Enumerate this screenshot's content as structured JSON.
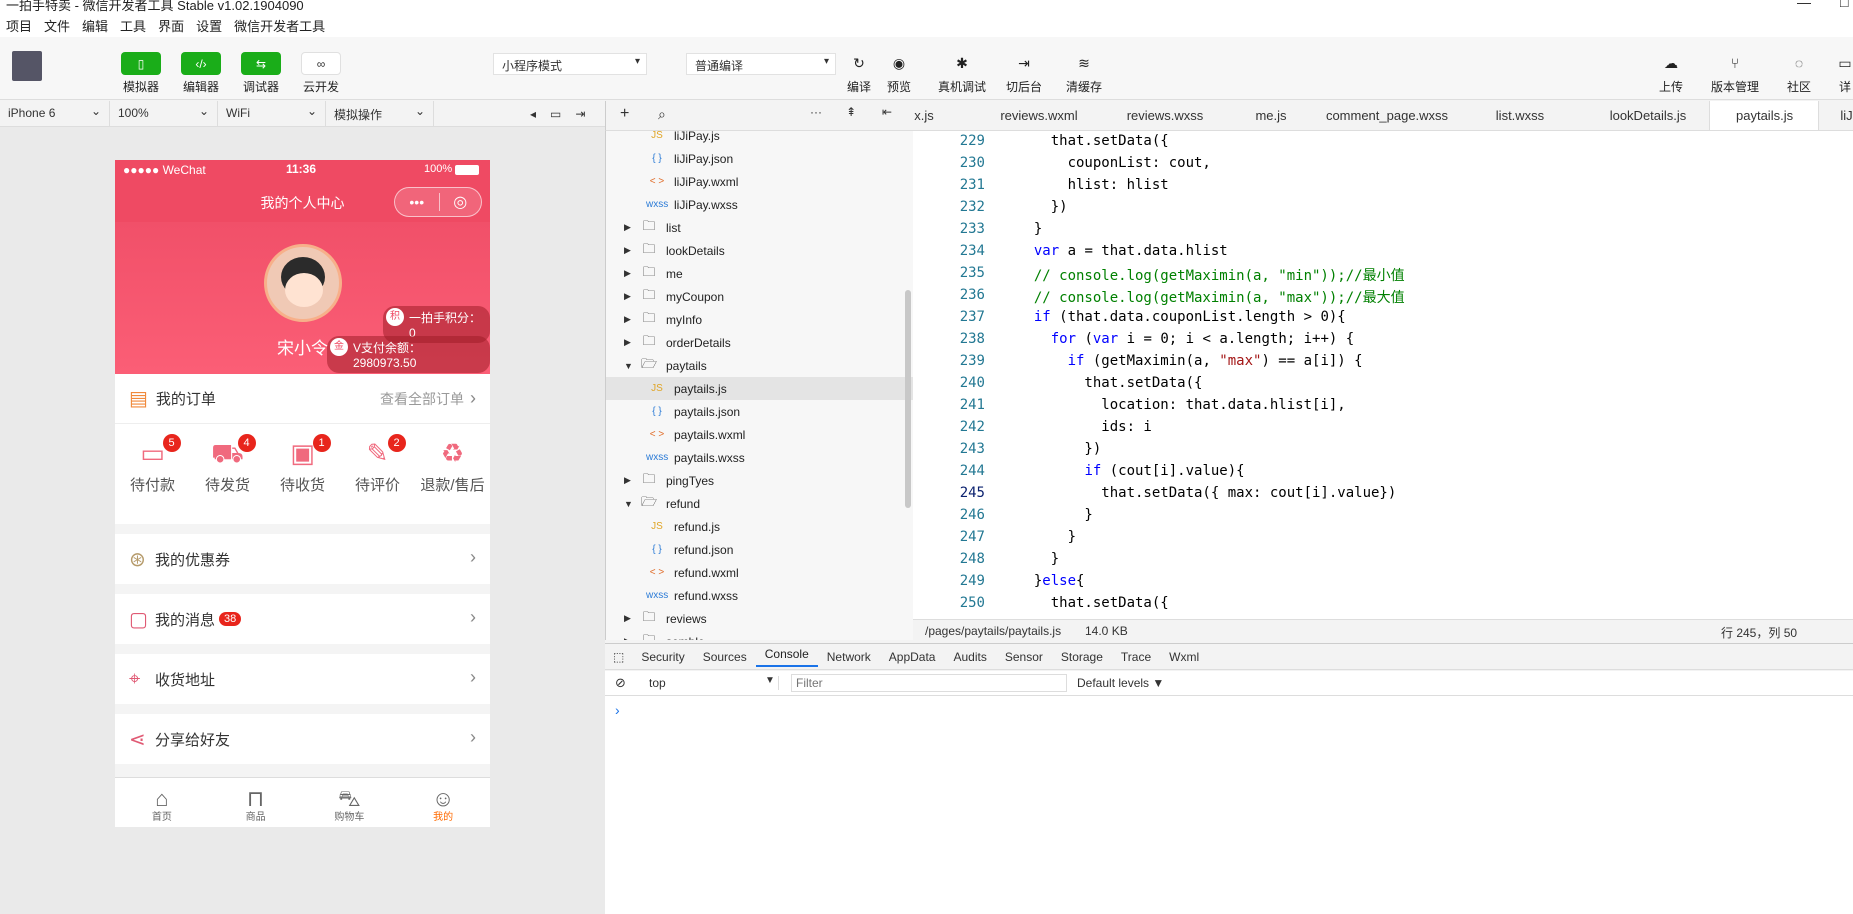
{
  "window": {
    "title": "一拍手特卖 - 微信开发者工具 Stable v1.02.1904090"
  },
  "menu": [
    "项目",
    "文件",
    "编辑",
    "工具",
    "界面",
    "设置",
    "微信开发者工具"
  ],
  "toolbar": {
    "simulator": "模拟器",
    "editor": "编辑器",
    "debugger": "调试器",
    "cloud": "云开发",
    "mode": "小程序模式",
    "compile_mode": "普通编译",
    "compile": "编译",
    "preview": "预览",
    "remote_debug": "真机调试",
    "background": "切后台",
    "clear_cache": "清缓存",
    "upload": "上传",
    "version": "版本管理",
    "community": "社区",
    "more": "详"
  },
  "simbar": {
    "device": "iPhone 6",
    "zoom": "100%",
    "network": "WiFi",
    "ops": "模拟操作"
  },
  "phone": {
    "carrier": "●●●●● WeChat",
    "time": "11:36",
    "battery": "100%",
    "nav_title": "我的个人中心",
    "username": "宋小令",
    "points": "一拍手积分：0",
    "balance": "V支付余额：2980973.50",
    "points_icon": "积",
    "balance_icon": "金",
    "orders_title": "我的订单",
    "orders_all": "查看全部订单",
    "order_items": [
      {
        "label": "待付款",
        "badge": "5"
      },
      {
        "label": "待发货",
        "badge": "4"
      },
      {
        "label": "待收货",
        "badge": "1"
      },
      {
        "label": "待评价",
        "badge": "2"
      },
      {
        "label": "退款/售后",
        "badge": ""
      }
    ],
    "coupons": "我的优惠券",
    "messages": "我的消息",
    "messages_badge": "38",
    "address": "收货地址",
    "share": "分享给好友",
    "tabs": [
      "首页",
      "商品",
      "购物车",
      "我的"
    ],
    "active_color": "#ff6a00"
  },
  "explorer": {
    "files": [
      {
        "name": "liJiPay.js",
        "type": "js"
      },
      {
        "name": "liJiPay.json",
        "type": "json"
      },
      {
        "name": "liJiPay.wxml",
        "type": "wxml"
      },
      {
        "name": "liJiPay.wxss",
        "type": "wxss"
      },
      {
        "name": "list",
        "type": "folder"
      },
      {
        "name": "lookDetails",
        "type": "folder"
      },
      {
        "name": "me",
        "type": "folder"
      },
      {
        "name": "myCoupon",
        "type": "folder"
      },
      {
        "name": "myInfo",
        "type": "folder"
      },
      {
        "name": "orderDetails",
        "type": "folder"
      },
      {
        "name": "paytails",
        "type": "folder-open"
      },
      {
        "name": "paytails.js",
        "type": "js"
      },
      {
        "name": "paytails.json",
        "type": "json"
      },
      {
        "name": "paytails.wxml",
        "type": "wxml"
      },
      {
        "name": "paytails.wxss",
        "type": "wxss"
      },
      {
        "name": "pingTyes",
        "type": "folder"
      },
      {
        "name": "refund",
        "type": "folder-open"
      },
      {
        "name": "refund.js",
        "type": "js"
      },
      {
        "name": "refund.json",
        "type": "json"
      },
      {
        "name": "refund.wxml",
        "type": "wxml"
      },
      {
        "name": "refund.wxss",
        "type": "wxss"
      },
      {
        "name": "reviews",
        "type": "folder"
      },
      {
        "name": "semble",
        "type": "folder"
      }
    ],
    "icon_js": "JS",
    "icon_json": "{ }",
    "icon_wxml": "< >",
    "icon_wxss": "wxss"
  },
  "editor": {
    "tabs": [
      "x.js",
      "reviews.wxml",
      "reviews.wxss",
      "me.js",
      "comment_page.wxss",
      "list.wxss",
      "lookDetails.js",
      "paytails.js",
      "liJi"
    ],
    "lines": [
      {
        "n": "229",
        "code": "    that.setData({"
      },
      {
        "n": "230",
        "code": "      couponList: cout,"
      },
      {
        "n": "231",
        "code": "      hlist: hlist"
      },
      {
        "n": "232",
        "code": "    })"
      },
      {
        "n": "233",
        "code": "  }"
      },
      {
        "n": "234",
        "code": "  var a = that.data.hlist"
      },
      {
        "n": "235",
        "code": "  // console.log(getMaximin(a, \"min\"));//最小值"
      },
      {
        "n": "236",
        "code": "  // console.log(getMaximin(a, \"max\"));//最大值"
      },
      {
        "n": "237",
        "code": "  if (that.data.couponList.length > 0){"
      },
      {
        "n": "238",
        "code": "    for (var i = 0; i < a.length; i++) {"
      },
      {
        "n": "239",
        "code": "      if (getMaximin(a, \"max\") == a[i]) {"
      },
      {
        "n": "240",
        "code": "        that.setData({"
      },
      {
        "n": "241",
        "code": "          location: that.data.hlist[i],"
      },
      {
        "n": "242",
        "code": "          ids: i"
      },
      {
        "n": "243",
        "code": "        })"
      },
      {
        "n": "244",
        "code": "        if (cout[i].value){"
      },
      {
        "n": "245",
        "code": "          that.setData({ max: cout[i].value})"
      },
      {
        "n": "246",
        "code": "        }"
      },
      {
        "n": "247",
        "code": "      }"
      },
      {
        "n": "248",
        "code": "    }"
      },
      {
        "n": "249",
        "code": "  }else{"
      },
      {
        "n": "250",
        "code": "    that.setData({"
      }
    ],
    "path": "/pages/paytails/paytails.js",
    "size": "14.0 KB",
    "cursor": "行 245，列 50"
  },
  "devtools": {
    "tabs": [
      "Security",
      "Sources",
      "Console",
      "Network",
      "AppData",
      "Audits",
      "Sensor",
      "Storage",
      "Trace",
      "Wxml"
    ],
    "active": "Console",
    "context": "top",
    "filter_placeholder": "Filter",
    "levels": "Default levels ▼",
    "prompt": "›"
  }
}
